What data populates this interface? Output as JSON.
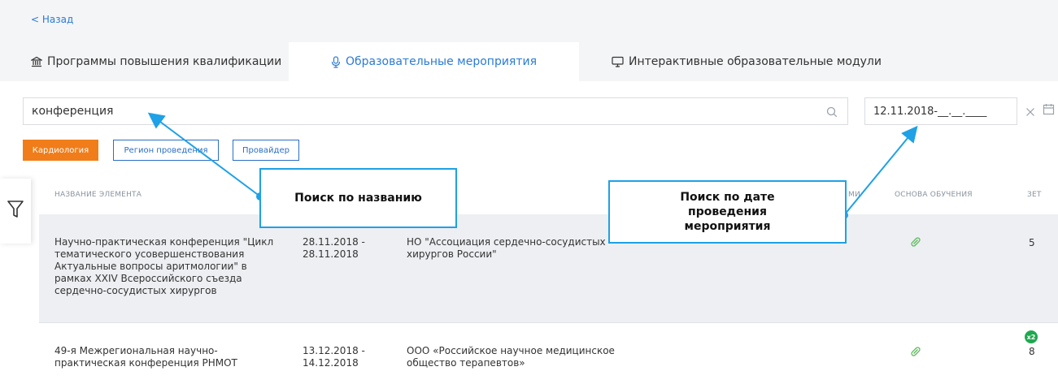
{
  "nav": {
    "back_label": "< Назад"
  },
  "tabs": [
    {
      "label": "Программы повышения квалификации",
      "icon": "bank-icon"
    },
    {
      "label": "Образовательные мероприятия",
      "icon": "microphone-icon",
      "active": true
    },
    {
      "label": "Интерактивные образовательные модули",
      "icon": "monitor-icon"
    }
  ],
  "search": {
    "value": "конференция"
  },
  "date_filter": {
    "value": "12.11.2018-__.__.____"
  },
  "chips": [
    {
      "label": "Кардиология",
      "style": "filled",
      "color": "#f07d1a"
    },
    {
      "label": "Регион проведения",
      "style": "outline"
    },
    {
      "label": "Провайдер",
      "style": "outline"
    }
  ],
  "table": {
    "headers": {
      "name": "НАЗВАНИЕ ЭЛЕМЕНТА",
      "partial": "МИ",
      "basis": "ОСНОВА ОБУЧЕНИЯ",
      "zet": "ЗЕТ"
    },
    "rows": [
      {
        "name": "Научно-практическая конференция \"Цикл тематического усовершенствования Актуальные вопросы аритмологии\" в рамках XXIV Всероссийского съезда сердечно-сосудистых хирургов",
        "dates": "28.11.2018 - 28.11.2018",
        "provider": "НО \"Ассоциация сердечно-сосудистых хирургов России\"",
        "basis_icon": "pill-icon",
        "zet": "5"
      },
      {
        "name": "49-я Межрегиональная научно-практическая конференция РНМОТ",
        "dates": "13.12.2018 - 14.12.2018",
        "provider": "ООО «Российское научное медицинское общество терапевтов»",
        "basis_icon": "pill-icon",
        "zet": "8",
        "badge": "x2"
      }
    ]
  },
  "callouts": {
    "search": "Поиск по названию",
    "date": "Поиск по дате проведения мероприятия"
  },
  "colors": {
    "accent": "#2a7bd5",
    "chip_orange": "#f07d1a",
    "callout_border": "#1ea1e6",
    "badge_green": "#1fa84f"
  }
}
